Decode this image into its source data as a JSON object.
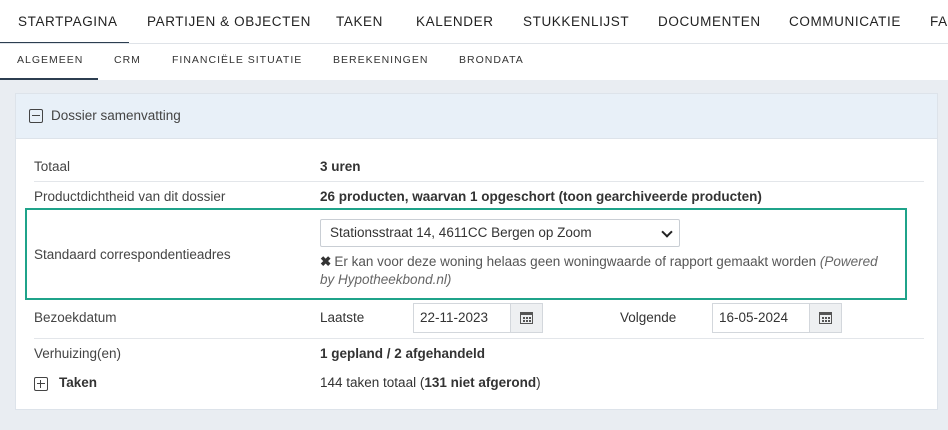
{
  "top_tabs": [
    "STARTPAGINA",
    "PARTIJEN & OBJECTEN",
    "TAKEN",
    "KALENDER",
    "STUKKENLIJST",
    "DOCUMENTEN",
    "COMMUNICATIE",
    "FAS"
  ],
  "sub_tabs": [
    "ALGEMEEN",
    "CRM",
    "FINANCIËLE SITUATIE",
    "BEREKENINGEN",
    "BRONDATA"
  ],
  "panel": {
    "title": "Dossier samenvatting"
  },
  "rows": {
    "totaal": {
      "label": "Totaal",
      "value": "3 uren"
    },
    "productdichtheid": {
      "label": "Productdichtheid van dit dossier",
      "value": "26 producten, waarvan 1 opgeschort (toon gearchiveerde producten)"
    },
    "correspondentie": {
      "label": "Standaard correspondentieadres",
      "selected": "Stationsstraat 14, 4611CC Bergen op Zoom",
      "warning": "Er kan voor deze woning helaas geen woningwaarde of rapport gemaakt worden",
      "powered_by": "(Powered by Hypotheekbond.nl)"
    },
    "bezoekdatum": {
      "label": "Bezoekdatum",
      "laatste_label": "Laatste",
      "laatste_value": "22-11-2023",
      "volgende_label": "Volgende",
      "volgende_value": "16-05-2024"
    },
    "verhuizing": {
      "label": "Verhuizing(en)",
      "value": "1 gepland / 2 afgehandeld"
    },
    "taken": {
      "label": "Taken",
      "value_prefix": "144 taken totaal (",
      "value_bold": "131 niet afgerond",
      "value_suffix": ")"
    }
  },
  "colors": {
    "highlight": "#1fa38a",
    "header_bg": "#e8f0f8",
    "page_bg": "#e9edf2"
  }
}
